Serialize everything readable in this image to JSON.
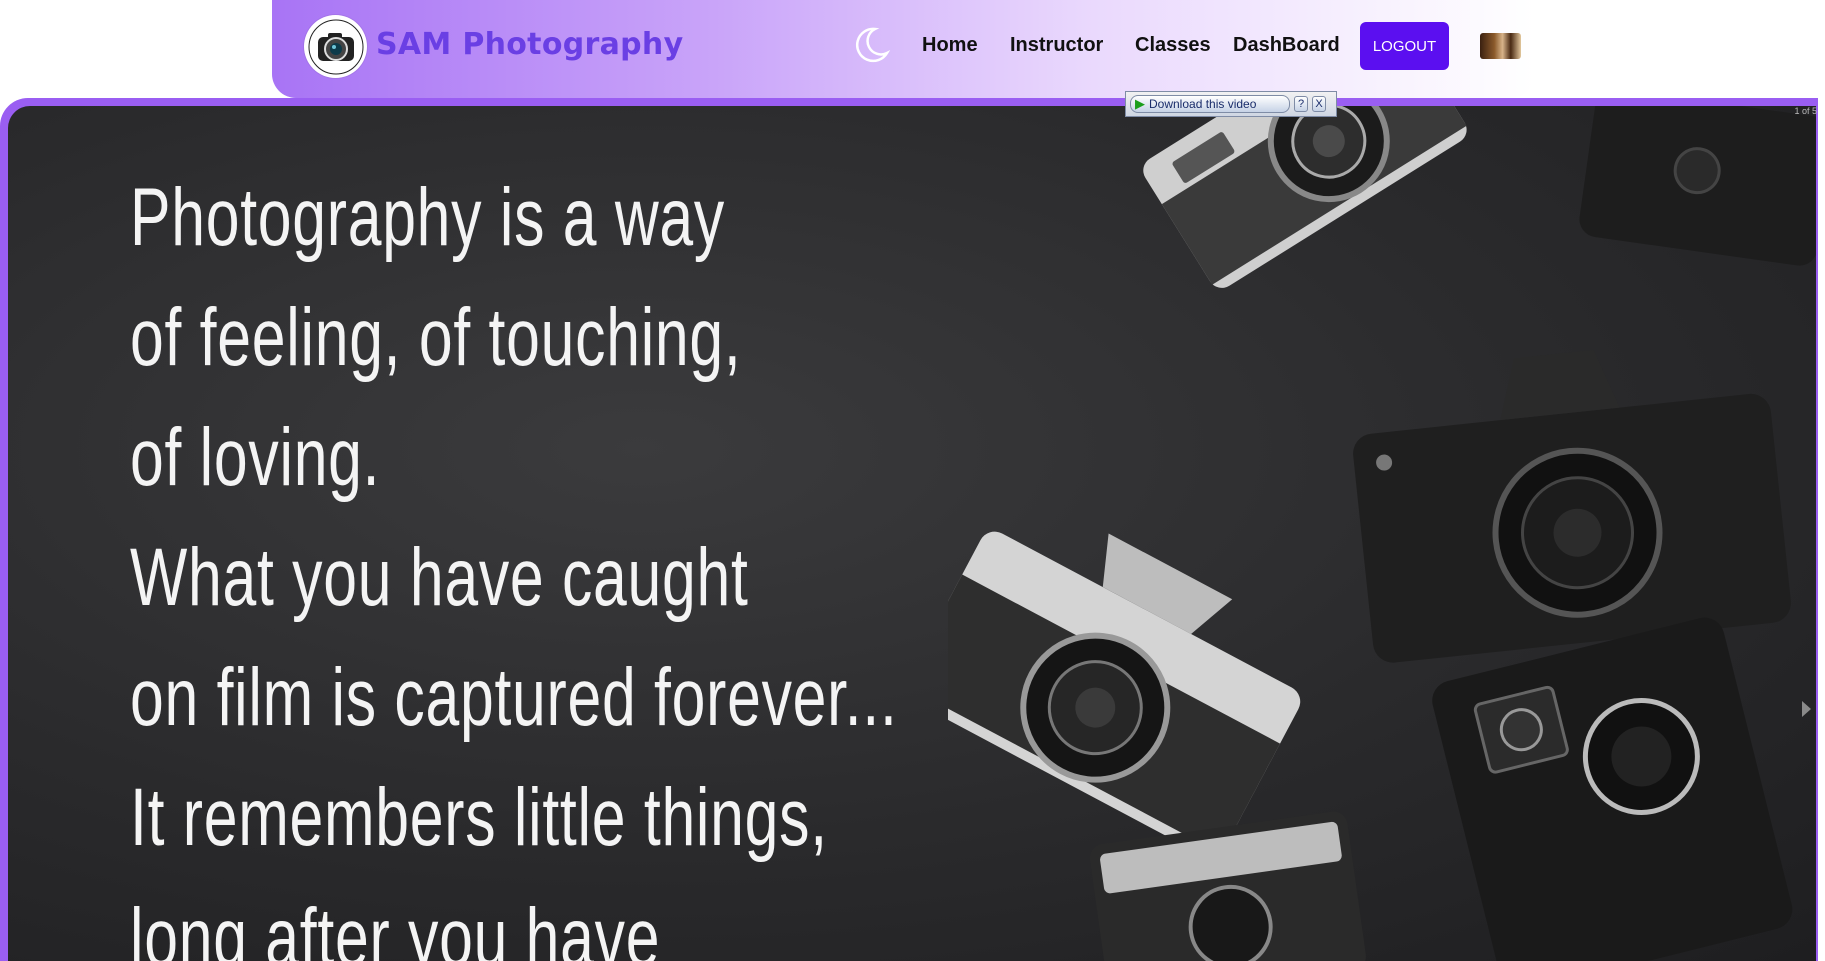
{
  "navbar": {
    "brand": "SAM Photography",
    "logo_icon": "camera-lens-logo-icon",
    "theme_toggle_icon": "moon-icon",
    "links": [
      "Home",
      "Instructor",
      "Classes",
      "DashBoard"
    ],
    "logout_label": "LOGOUT",
    "avatar_icon": "user-avatar-icon"
  },
  "download_bar": {
    "label": "Download this video",
    "help_label": "?",
    "close_label": "X"
  },
  "hero": {
    "quote_lines": [
      "Photography is a way",
      "of feeling, of touching,",
      "of loving.",
      "What you have caught",
      "on film is captured forever...",
      "It remembers little things,",
      "long after you have"
    ],
    "slide_counter": "1 of 5",
    "next_icon": "chevron-right-icon"
  },
  "colors": {
    "brand": "#6a3fe4",
    "logout_bg": "#5b0ff0",
    "nav_gradient_start": "#a874f5",
    "hero_border": "#9a5ef2",
    "hero_bg": "#2a2a2c"
  }
}
